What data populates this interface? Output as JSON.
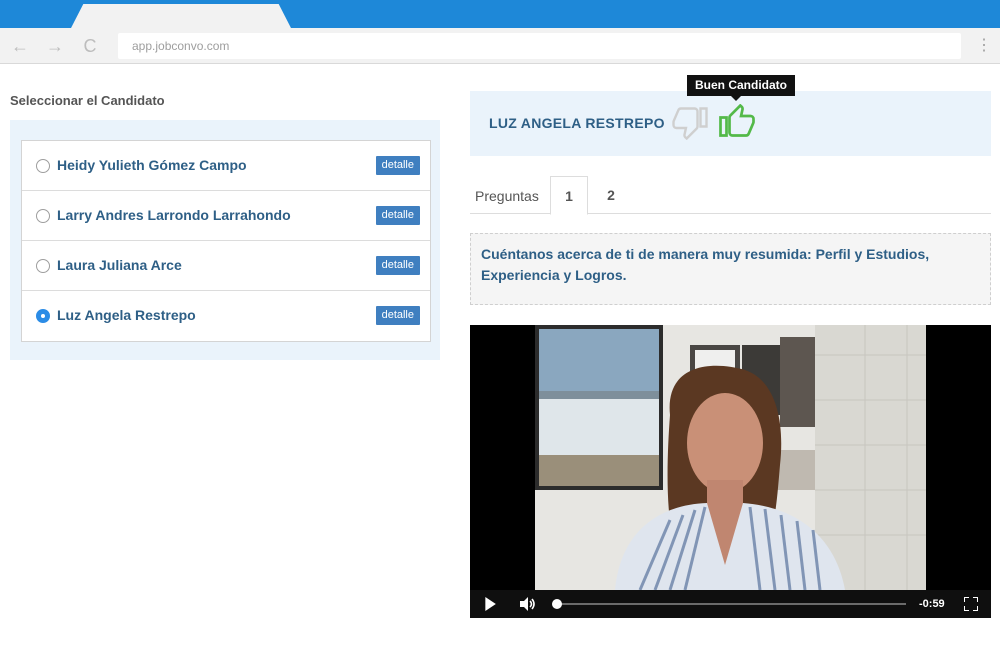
{
  "browser": {
    "url": "app.jobconvo.com",
    "back_label": "←",
    "forward_label": "→",
    "reload_label": "C",
    "menu_label": "⋮"
  },
  "left": {
    "title": "Seleccionar el Candidato",
    "detalle_label": "detalle",
    "candidates": [
      {
        "name": "Heidy Yulieth Gómez Campo",
        "selected": false
      },
      {
        "name": "Larry Andres Larrondo Larrahondo",
        "selected": false
      },
      {
        "name": "Laura Juliana Arce",
        "selected": false
      },
      {
        "name": "Luz Angela Restrepo",
        "selected": true
      }
    ]
  },
  "right": {
    "selected_name": "LUZ ANGELA RESTREPO",
    "tooltip": "Buen Candidato",
    "tabs": {
      "label": "Preguntas",
      "items": [
        "1",
        "2"
      ],
      "active_index": 0
    },
    "question": "Cuéntanos acerca de ti de manera muy resumida: Perfil y Estudios, Experiencia y Logros.",
    "video": {
      "time": "-0:59"
    }
  },
  "colors": {
    "chrome_blue": "#1e88d8",
    "name_blue": "#2e5f86",
    "button_blue": "#3f7fc0",
    "panel_bg": "#eaf3fb",
    "thumb_up_green": "#53b948",
    "thumb_down_gray": "#cfcfcf"
  }
}
